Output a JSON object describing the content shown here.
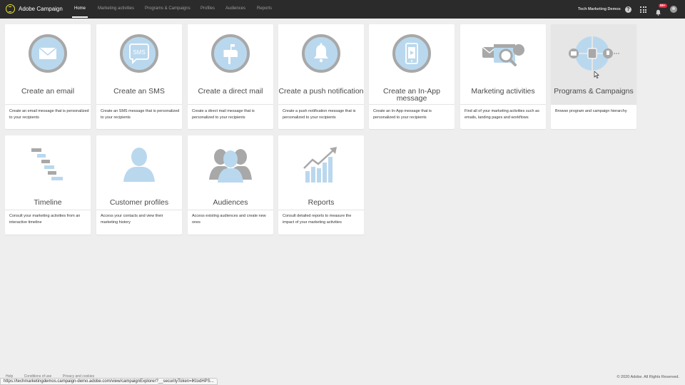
{
  "app": {
    "name": "Adobe Campaign"
  },
  "nav": {
    "items": [
      {
        "label": "Home",
        "active": true
      },
      {
        "label": "Marketing activities"
      },
      {
        "label": "Programs & Campaigns"
      },
      {
        "label": "Profiles"
      },
      {
        "label": "Audiences"
      },
      {
        "label": "Reports"
      }
    ]
  },
  "header": {
    "org_name": "Tech Marketing Demos",
    "help_label": "?",
    "notification_count": "99+"
  },
  "cards": [
    {
      "title": "Create an email",
      "description": "Create an email message that is personalized to your recipients",
      "icon": "email-icon"
    },
    {
      "title": "Create an SMS",
      "description": "Create an SMS message that is personalized to your recipients",
      "icon": "sms-icon",
      "icon_text": "SMS"
    },
    {
      "title": "Create a direct mail",
      "description": "Create a direct mail message that is personalized to your recipients",
      "icon": "mailbox-icon"
    },
    {
      "title": "Create a push notification",
      "description": "Create a push notification message that is personalized to your recipients",
      "icon": "bell-icon"
    },
    {
      "title_line1": "Create an In-App",
      "title_line2": "message",
      "description": "Create an In-App message that is personalized to your recipients",
      "icon": "mobile-app-icon"
    },
    {
      "title": "Marketing activities",
      "description": "Find all of your marketing activities such as emails, landing pages and workflows",
      "icon": "marketing-activities-icon"
    },
    {
      "title": "Programs & Campaigns",
      "description": "Browse program and campaign hierarchy",
      "icon": "programs-campaigns-icon"
    },
    {
      "title": "Timeline",
      "description": "Consult your marketing activities from an interactive timeline",
      "icon": "timeline-icon"
    },
    {
      "title": "Customer profiles",
      "description": "Access your contacts and view their marketing history",
      "icon": "profile-icon"
    },
    {
      "title": "Audiences",
      "description": "Access existing audiences and create new ones",
      "icon": "audiences-icon"
    },
    {
      "title": "Reports",
      "description": "Consult detailed reports to measure the impact of your marketing activities",
      "icon": "reports-chart-icon"
    }
  ],
  "footer": {
    "links": [
      "Help",
      "Conditions of use",
      "Privacy and cookies"
    ],
    "copyright": "© 2020 Adobe. All Rights Reserved.",
    "status_url": "https://techmarketingdemos.campaign-demo.adobe.com/view/campaignExplorer?__securityToken=lKtodHPS..."
  },
  "colors": {
    "topbar": "#2b2b2b",
    "brand_accent": "#e9e430",
    "icon_blue": "#b9d8ee",
    "icon_gray": "#a8a8a8",
    "badge_red": "#e0283c"
  }
}
